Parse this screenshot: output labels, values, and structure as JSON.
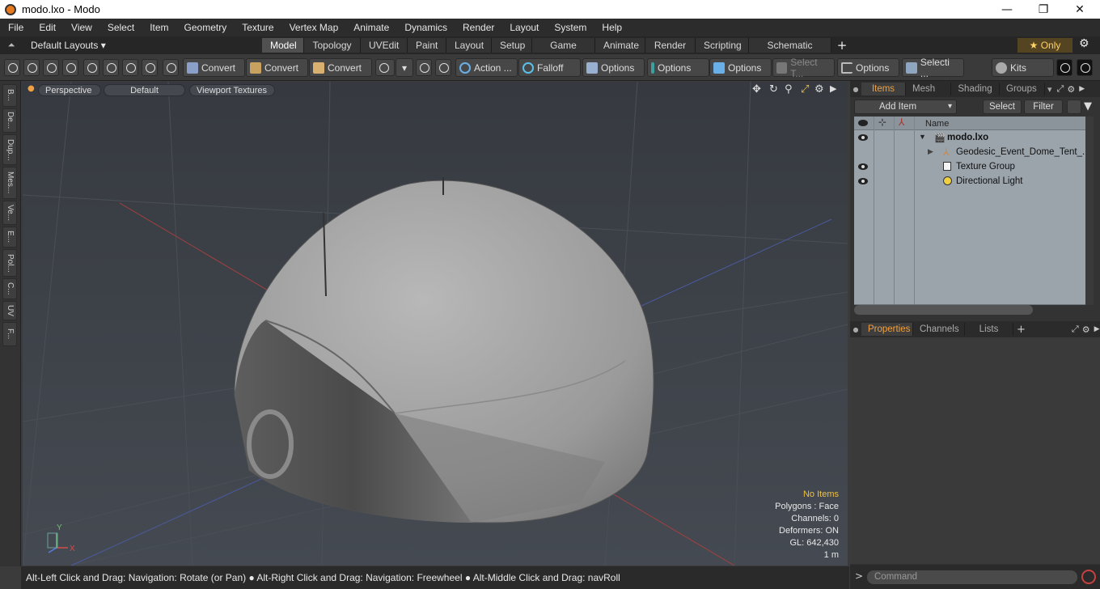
{
  "window": {
    "title": "modo.lxo - Modo",
    "min": "—",
    "max": "❐",
    "close": "✕"
  },
  "menu": [
    "File",
    "Edit",
    "View",
    "Select",
    "Item",
    "Geometry",
    "Texture",
    "Vertex Map",
    "Animate",
    "Dynamics",
    "Render",
    "Layout",
    "System",
    "Help"
  ],
  "layouts": {
    "default_label": "Default Layouts ▾",
    "tabs": [
      "Model",
      "Topology",
      "UVEdit",
      "Paint",
      "Layout",
      "Setup",
      "Game Tools",
      "Animate",
      "Render",
      "Scripting",
      "Schematic Fusion"
    ],
    "active": "Model",
    "add": "+",
    "only_label": "★  Only",
    "gear": "⚙"
  },
  "toolbar": {
    "convert1": "Convert",
    "convert2": "Convert",
    "convert3": "Convert",
    "action": "Action ...",
    "falloff": "Falloff",
    "options1": "Options",
    "options2": "Options",
    "options3": "Options",
    "select_t": "Select T...",
    "options4": "Options",
    "selecti": "Selecti ...",
    "kits": "Kits"
  },
  "left_tabs": [
    "B...",
    "De...",
    "Dup...",
    "Mes...",
    "Ve...",
    "E...",
    "Pol...",
    "C...",
    "UV",
    "F..."
  ],
  "viewport": {
    "perspective": "Perspective",
    "default": "Default",
    "textures": "Viewport Textures",
    "info": {
      "no_items": "No Items",
      "polygons": "Polygons : Face",
      "channels": "Channels: 0",
      "deformers": "Deformers: ON",
      "gl": "GL: 642,430",
      "scale": "1 m"
    },
    "axis_labels": {
      "x": "X",
      "y": "Y",
      "z": "Z"
    }
  },
  "status": "Alt-Left Click and Drag: Navigation: Rotate (or Pan) ● Alt-Right Click and Drag: Navigation: Freewheel ● Alt-Middle Click and Drag: navRoll",
  "items_panel": {
    "tabs": [
      "Items",
      "Mesh ...",
      "Shading",
      "Groups"
    ],
    "active_tab": "Items",
    "add_item": "Add Item",
    "select": "Select",
    "filter": "Filter",
    "name_header": "Name",
    "rows": [
      "modo.lxo",
      "Geodesic_Event_Dome_Tent_...",
      "Texture Group",
      "Directional Light"
    ]
  },
  "properties_panel": {
    "tabs": [
      "Properties",
      "Channels",
      "Lists"
    ],
    "active_tab": "Properties",
    "add": "+"
  },
  "command": {
    "prompt": ">",
    "placeholder": "Command"
  },
  "colors": {
    "accent": "#f0a040",
    "viewport_bg": "#3a3e44",
    "dome": "#9c9c9c",
    "active_tab": "#505050"
  }
}
